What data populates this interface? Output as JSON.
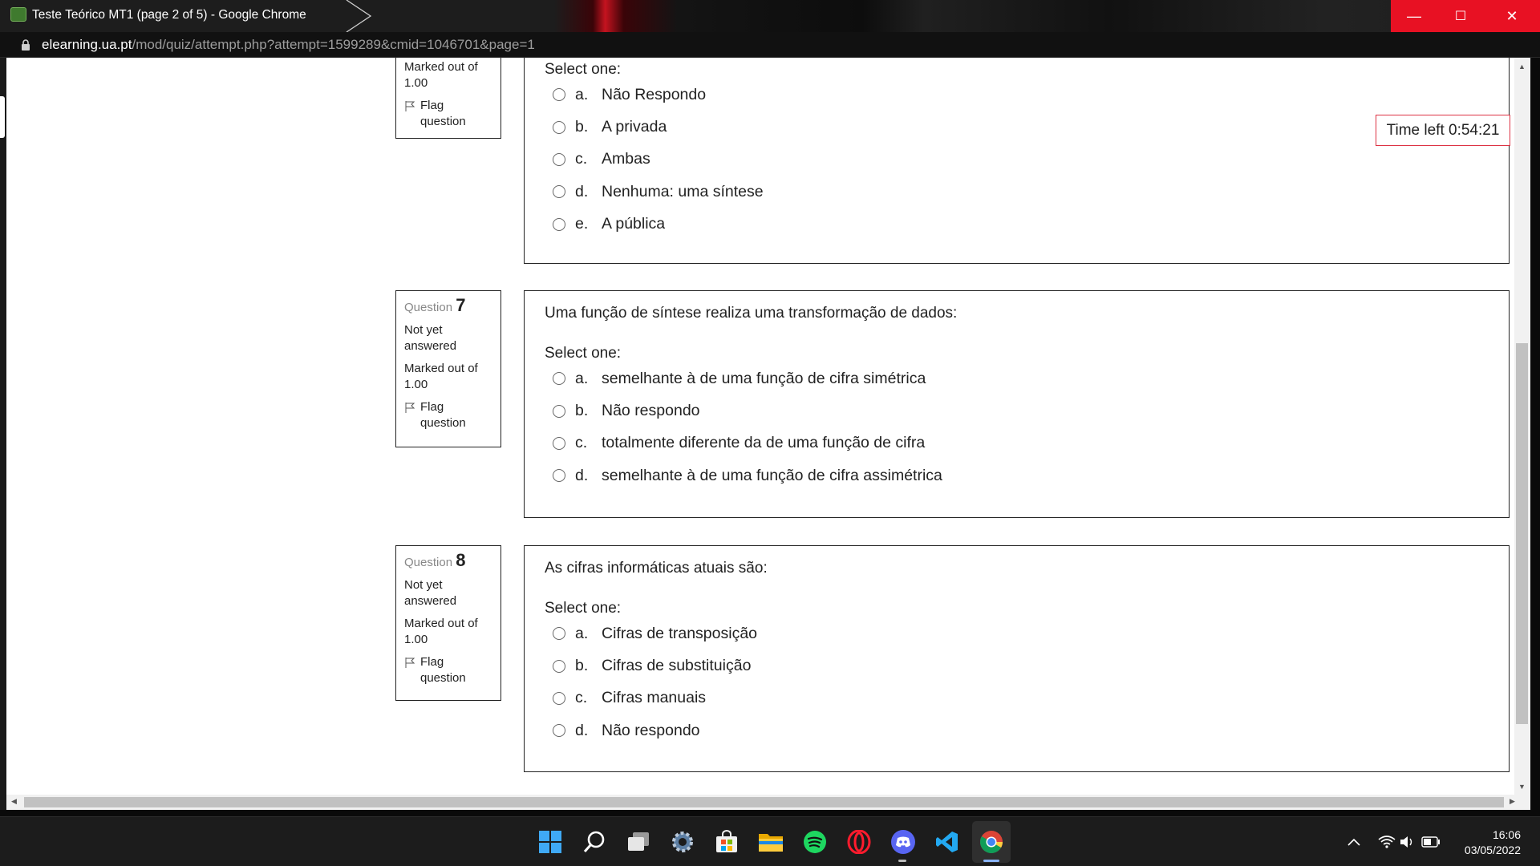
{
  "window": {
    "title": "Teste Teórico MT1 (page 2 of 5) - Google Chrome",
    "minimize": "—",
    "maximize": "☐",
    "close": "✕"
  },
  "address": {
    "domain": "elearning.ua.pt",
    "path": "/mod/quiz/attempt.php?attempt=1599289&cmid=1046701&page=1"
  },
  "timer": "Time left 0:54:21",
  "select_one_label": "Select one:",
  "questions": [
    {
      "info": {
        "marked": "Marked out of 1.00",
        "flag": "Flag question"
      },
      "text": "",
      "options": [
        {
          "letter": "a.",
          "text": "Não Respondo"
        },
        {
          "letter": "b.",
          "text": "A privada"
        },
        {
          "letter": "c.",
          "text": "Ambas"
        },
        {
          "letter": "d.",
          "text": "Nenhuma: uma síntese"
        },
        {
          "letter": "e.",
          "text": "A pública"
        }
      ]
    },
    {
      "info": {
        "label": "Question",
        "number": "7",
        "status": "Not yet answered",
        "marked": "Marked out of 1.00",
        "flag": "Flag question"
      },
      "text": "Uma função de síntese realiza uma transformação de dados:",
      "options": [
        {
          "letter": "a.",
          "text": "semelhante à de uma função de cifra simétrica"
        },
        {
          "letter": "b.",
          "text": "Não respondo"
        },
        {
          "letter": "c.",
          "text": "totalmente diferente da de uma função de cifra"
        },
        {
          "letter": "d.",
          "text": "semelhante à de uma função de cifra assimétrica"
        }
      ]
    },
    {
      "info": {
        "label": "Question",
        "number": "8",
        "status": "Not yet answered",
        "marked": "Marked out of 1.00",
        "flag": "Flag question"
      },
      "text": "As cifras informáticas atuais são:",
      "options": [
        {
          "letter": "a.",
          "text": "Cifras de transposição"
        },
        {
          "letter": "b.",
          "text": "Cifras de substituição"
        },
        {
          "letter": "c.",
          "text": "Cifras manuais"
        },
        {
          "letter": "d.",
          "text": "Não respondo"
        }
      ]
    }
  ],
  "taskbar": {
    "apps": [
      "start-icon",
      "search-icon",
      "task-view-icon",
      "settings-icon",
      "store-icon",
      "file-explorer-icon",
      "spotify-icon",
      "opera-icon",
      "discord-icon",
      "vscode-icon",
      "chrome-icon"
    ],
    "time": "16:06",
    "date": "03/05/2022"
  },
  "colors": {
    "close_red": "#e81123",
    "timer_border": "#dd3344",
    "chrome_indicator": "#8ab4f8"
  }
}
